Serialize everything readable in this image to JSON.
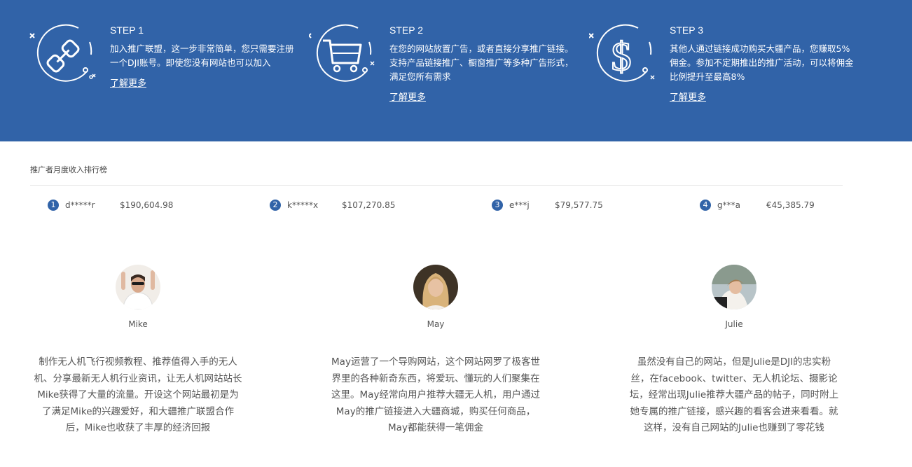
{
  "steps": [
    {
      "title": "STEP 1",
      "desc": "加入推广联盟，这一步非常简单，您只需要注册一个DJI账号。即使您没有网站也可以加入",
      "link": "了解更多",
      "icon": "chain-link-icon"
    },
    {
      "title": "STEP 2",
      "desc": "在您的网站放置广告，或者直接分享推广链接。支持产品链接推广、橱窗推广等多种广告形式，满足您所有需求",
      "link": "了解更多",
      "icon": "shopping-cart-icon"
    },
    {
      "title": "STEP 3",
      "desc": "其他人通过链接成功购买大疆产品，您赚取5%佣金。参加不定期推出的推广活动，可以将佣金比例提升至最高8%",
      "link": "了解更多",
      "icon": "dollar-icon"
    }
  ],
  "ranking": {
    "title": "推广者月度收入排行榜",
    "items": [
      {
        "rank": "1",
        "name": "d*****r",
        "amount": "$190,604.98"
      },
      {
        "rank": "2",
        "name": "k*****x",
        "amount": "$107,270.85"
      },
      {
        "rank": "3",
        "name": "e***j",
        "amount": "$79,577.75"
      },
      {
        "rank": "4",
        "name": "g***a",
        "amount": "€45,385.79"
      }
    ]
  },
  "people": [
    {
      "name": "Mike",
      "story": "制作无人机飞行视频教程、推荐值得入手的无人机、分享最新无人机行业资讯，让无人机网站站长Mike获得了大量的流量。开设这个网站最初是为了满足Mike的兴趣爱好，和大疆推广联盟合作后，Mike也收获了丰厚的经济回报"
    },
    {
      "name": "May",
      "story": "May运营了一个导购网站，这个网站网罗了极客世界里的各种新奇东西，将爱玩、懂玩的人们聚集在这里。May经常向用户推荐大疆无人机，用户通过May的推广链接进入大疆商城，购买任何商品，May都能获得一笔佣金"
    },
    {
      "name": "Julie",
      "story": "虽然没有自己的网站，但是Julie是DJI的忠实粉丝，在facebook、twitter、无人机论坛、摄影论坛，经常出现Julie推荐大疆产品的帖子，同时附上她专属的推广链接，感兴趣的看客会进来看看。就这样，没有自己网站的Julie也赚到了零花钱"
    }
  ],
  "colors": {
    "banner": "#3163a8",
    "accent": "#3163a8"
  }
}
